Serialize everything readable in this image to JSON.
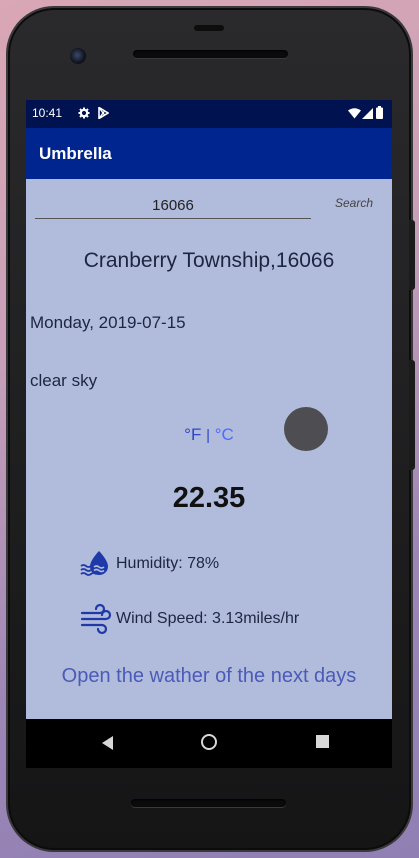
{
  "statusbar": {
    "time": "10:41",
    "icons_left": [
      "gear-icon",
      "play-store-icon"
    ],
    "icons_right": [
      "wifi-icon",
      "signal-icon",
      "battery-icon"
    ]
  },
  "appbar": {
    "title": "Umbrella"
  },
  "search": {
    "zip_value": "16066",
    "button_label": "Search"
  },
  "weather": {
    "location": "Cranberry Township,16066",
    "date": "Monday, 2019-07-15",
    "description": "clear sky",
    "unit_f": "°F",
    "unit_separator": "|",
    "unit_c": "°C",
    "temperature": "22.35",
    "humidity_label": "Humidity: 78%",
    "wind_label": "Wind Speed: 3.13miles/hr"
  },
  "next_days_link": "Open the wather of the next days",
  "colors": {
    "statusbar": "#00124f",
    "appbar": "#00258f",
    "content_bg": "#b1bbdc",
    "accent_link": "#4a5bb8",
    "icon_blue": "#1f3aa8"
  }
}
